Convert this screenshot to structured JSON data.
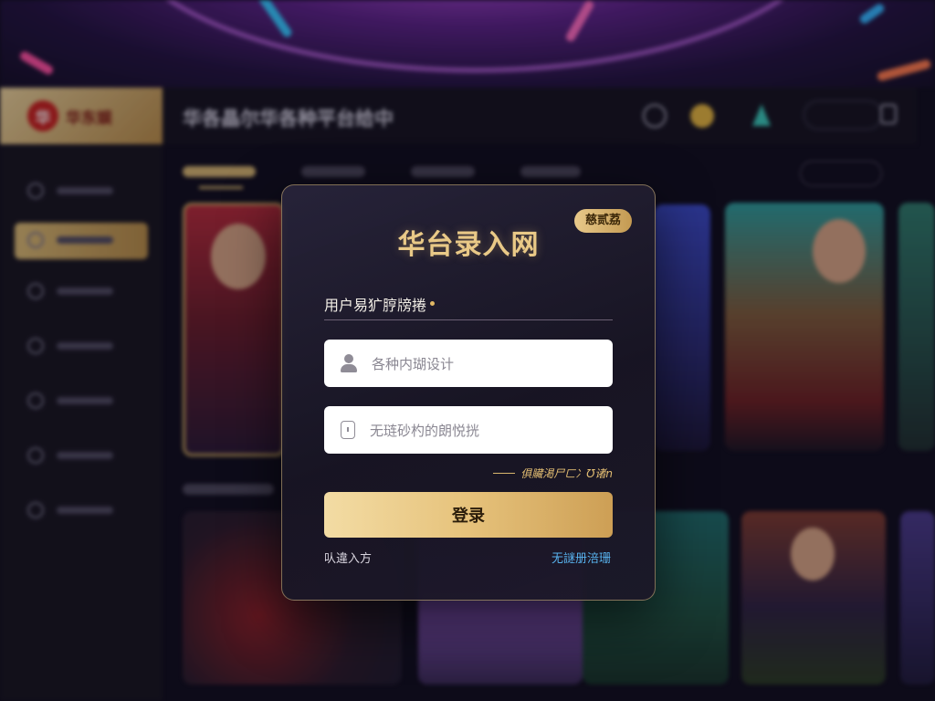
{
  "header": {
    "logo_text": "华东娱",
    "logo_mark": "华",
    "title": "华各晶尔华各种平台给中"
  },
  "modal": {
    "badge": "慈贰荔",
    "title": "华台录入网",
    "field_label": "用户易犷脝牓捲",
    "username_placeholder": "各种内瑚设计",
    "password_placeholder": "无琏砂杓的朗悦挄",
    "forgot_link": "俱贜渇尸ㄈ冫Ʊ诸n",
    "login_button": "登录",
    "bottom_left_link": "㕥違入方",
    "bottom_right_link": "无謎册涪珊"
  },
  "colors": {
    "accent_gold": "#e6c27b",
    "link_blue": "#58b3ef",
    "background": "#0f0c1c",
    "modal_border": "#d7b97d"
  },
  "icons": {
    "username": "user-icon",
    "password": "lock-icon"
  }
}
